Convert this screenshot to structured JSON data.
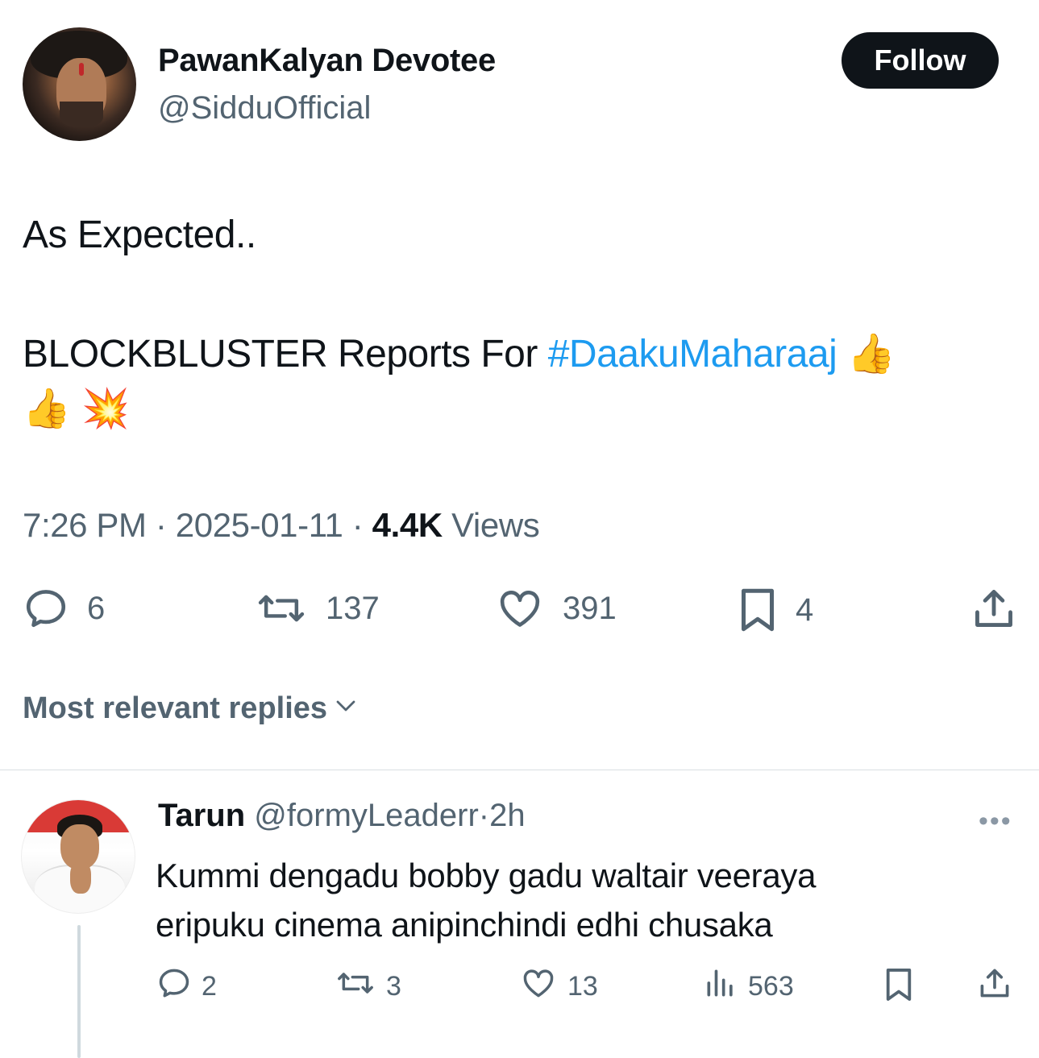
{
  "author": {
    "display_name": "PawanKalyan Devotee",
    "handle": "@SidduOfficial",
    "follow_label": "Follow"
  },
  "tweet": {
    "line1": "As Expected..",
    "line2_prefix": "BLOCKBLUSTER Reports For ",
    "hashtag": "#DaakuMaharaaj",
    "emoji_thumb": "👍",
    "emoji_boom": "💥",
    "time": "7:26 PM",
    "date": "2025-01-11",
    "views_count": "4.4K",
    "views_label": "Views",
    "sep": "·"
  },
  "actions": {
    "replies": "6",
    "reposts": "137",
    "likes": "391",
    "bookmarks": "4"
  },
  "replies_sort_label": "Most relevant replies",
  "reply": {
    "name": "Tarun",
    "handle": "@formyLeaderr",
    "sep": "·",
    "time": "2h",
    "more": "•••",
    "text_line1": "Kummi dengadu bobby gadu waltair veeraya",
    "text_line2": "eripuku cinema anipinchindi edhi chusaka",
    "replies": "2",
    "reposts": "3",
    "likes": "13",
    "views": "563"
  },
  "colors": {
    "text": "#0f1419",
    "muted": "#536471",
    "link": "#1d9bf0",
    "follow_bg": "#0f1419"
  },
  "icons": [
    "reply-icon",
    "repost-icon",
    "like-icon",
    "bookmark-icon",
    "share-icon",
    "views-icon",
    "chevron-down-icon",
    "more-icon"
  ]
}
